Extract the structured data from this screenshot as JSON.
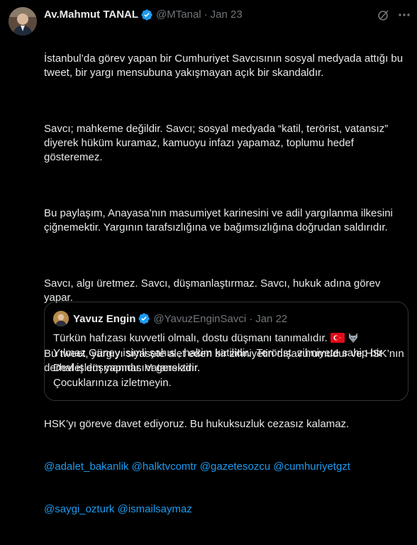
{
  "tweet": {
    "author_name": "Av.Mahmut TANAL",
    "handle": "@MTanal",
    "separator": "·",
    "date": "Jan 23",
    "paragraphs": [
      "İstanbul’da görev yapan bir Cumhuriyet Savcısının sosyal medyada attığı bu tweet, bir yargı mensubuna yakışmayan açık bir skandaldır.",
      "Savcı; mahkeme değildir. Savcı; sosyal medyada “katil, terörist, vatansız” diyerek hüküm kuramaz, kamuoyu infazı yapamaz, toplumu hedef gösteremez.",
      "Bu paylaşım, Anayasa’nın masumiyet karinesini ve adil yargılanma ilkesini çiğnemektir. Yargının tarafsızlığına ve bağımsızlığına doğrudan saldırıdır.",
      "Savcı, algı üretmez. Savcı, düşmanlaştırmaz. Savcı, hukuk adına görev yapar.",
      "Bu tweet, yargıyı siyasete alet eden bir zihniyetin dışavurumudur ve HSK’nın derhal işlem yapmasını gerektirir."
    ],
    "final_text": "HSK’yı göreve davet ediyoruz. Bu hukuksuzluk cezasız kalamaz.",
    "mentions": [
      "@adalet_bakanlik",
      "@halktvcomtr",
      "@gazetesozcu",
      "@cumhuriyetgzt",
      "@saygi_ozturk",
      "@ismailsaymaz"
    ]
  },
  "quote": {
    "author_name": "Yavuz Engin",
    "handle": "@YavuzEnginSavci",
    "separator": "·",
    "date": "Jan 22",
    "lines": [
      "Türkün hafızası kuvvetli olmalı, dostu düşmanı tanımalıdır.",
      "Yılmaz Güney isimli şahıs , hakim katilidir.  Terörist  zihniyete sahip bir",
      "Devlet düşmanıdır. Vatansızdır.",
      "Çocuklarınıza izletmeyin."
    ],
    "line1_emojis": [
      "turkey-flag",
      "wolf"
    ]
  },
  "colors": {
    "background": "#000000",
    "text": "#e7e9ea",
    "secondary": "#71767b",
    "link": "#1d9bf0",
    "verified": "#1d9bf0",
    "border": "#2f3336"
  },
  "icons": [
    "verified-badge-icon",
    "grok-icon",
    "more-options-icon",
    "turkey-flag-icon",
    "wolf-icon"
  ]
}
